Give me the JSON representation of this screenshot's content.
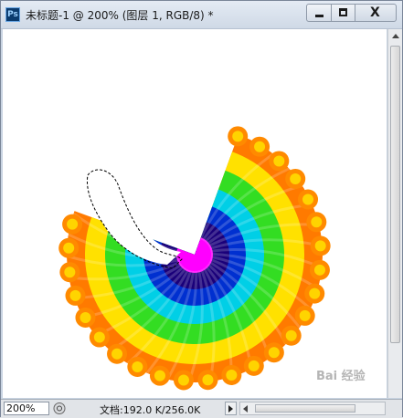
{
  "app": {
    "icon_text": "Ps"
  },
  "window": {
    "title": "未标题-1 @ 200% (图层 1, RGB/8) *",
    "minimize_glyph": "",
    "maximize_glyph": "",
    "close_glyph": "X"
  },
  "canvas": {
    "artwork": "spiral-rainbow-fan",
    "colors": [
      "#ff7a00",
      "#ffe100",
      "#33dd22",
      "#00cfe6",
      "#0030d0",
      "#1a007a",
      "#ff00ff"
    ]
  },
  "status": {
    "zoom": "200%",
    "doc_info": "文档:192.0 K/256.0K"
  },
  "watermark": {
    "text": "Bai 经验"
  }
}
